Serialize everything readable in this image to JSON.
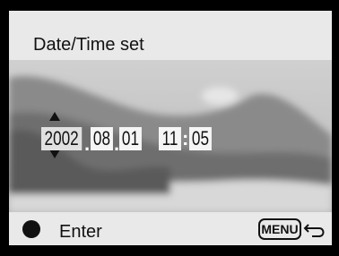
{
  "header": {
    "title": "Date/Time set"
  },
  "datetime": {
    "year": "2002",
    "month": "08",
    "day": "01",
    "hour": "11",
    "minute": "05",
    "date_separator": ".",
    "time_separator": ":"
  },
  "footer": {
    "enter_label": "Enter",
    "menu_label": "MENU"
  },
  "icons": {
    "enter": "filled-circle-icon",
    "back": "return-arrow-icon",
    "adjust": "up-down-arrow-icon"
  }
}
